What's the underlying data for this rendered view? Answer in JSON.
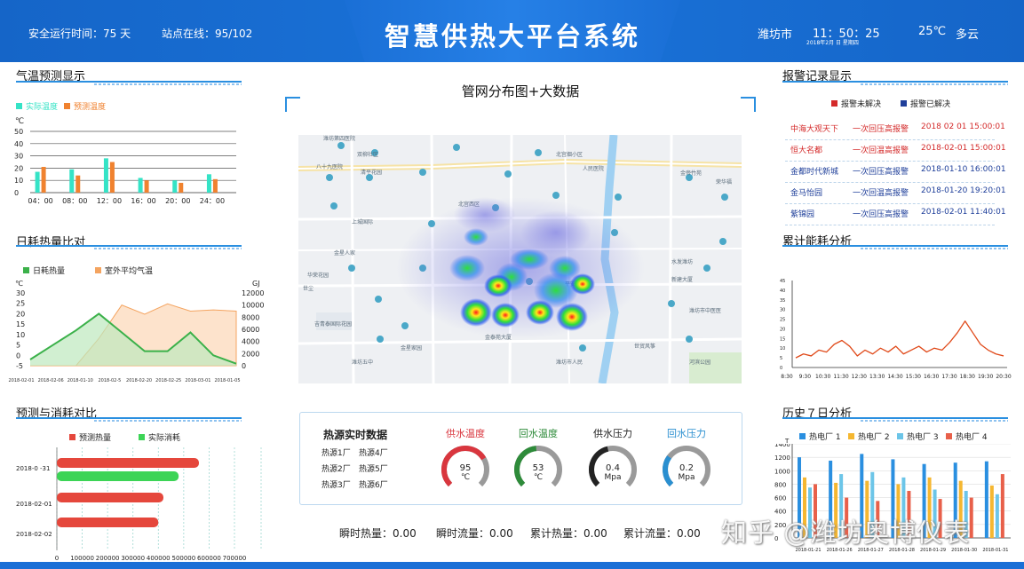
{
  "header": {
    "runtime": "安全运行时间：75 天",
    "stations": "站点在线：95/102",
    "title": "智慧供热大平台系统",
    "city": "潍坊市",
    "time": "11：50：25",
    "date": "2018年2月 日 星期四",
    "temperature": "25℃",
    "weather": "多云"
  },
  "temp_forecast": {
    "title": "气温预测显示",
    "legend": [
      "实际温度",
      "预测温度"
    ],
    "unit": "℃",
    "colors": [
      "#35e3c6",
      "#f0822f"
    ],
    "chart_data": {
      "type": "bar",
      "categories": [
        "04：00",
        "08：00",
        "12：00",
        "16：00",
        "20：00",
        "24：00"
      ],
      "yticks": [
        "50",
        "40",
        "30",
        "20",
        "10",
        "0"
      ],
      "series": [
        {
          "name": "实际温度",
          "values": [
            17,
            19,
            28,
            12,
            10,
            15
          ]
        },
        {
          "name": "预测温度",
          "values": [
            21,
            14,
            25,
            10,
            8,
            11
          ]
        }
      ],
      "ylim": [
        0,
        50
      ]
    }
  },
  "daily_heat": {
    "title": "日耗热量比对",
    "legend": [
      "日耗热量",
      "室外平均气温"
    ],
    "unit_left": "℃",
    "unit_right": "GJ",
    "colors": [
      "#3bb14a",
      "#f4a460"
    ],
    "chart_data": {
      "type": "area",
      "categories": [
        "2018-02-01",
        "2018-02-06",
        "2018-01-10",
        "2018-02-5",
        "2018-02-20",
        "2018-02-25",
        "2018-03-01",
        "2018-01-05"
      ],
      "yticks_left": [
        "30",
        "25",
        "20",
        "15",
        "10",
        "5",
        "0",
        "-5"
      ],
      "yticks_right": [
        "12000",
        "10000",
        "8000",
        "6000",
        "4000",
        "2000",
        "0"
      ],
      "series": [
        {
          "name": "日耗热量",
          "axis": "left",
          "values": [
            -2,
            5,
            12,
            20,
            11,
            2,
            2,
            11,
            0,
            -4
          ]
        },
        {
          "name": "室外平均气温",
          "axis": "right",
          "values": [
            0,
            0,
            0,
            4500,
            10000,
            8500,
            10200,
            9000,
            9200,
            9000
          ]
        }
      ],
      "ylim_left": [
        -5,
        30
      ],
      "ylim_right": [
        0,
        12000
      ]
    }
  },
  "forecast_vs": {
    "title": "预测与消耗对比",
    "legend": [
      "预测热量",
      "实际消耗"
    ],
    "colors": [
      "#e5473c",
      "#3cd456"
    ],
    "chart_data": {
      "type": "bar",
      "orientation": "horizontal",
      "categories": [
        "2018-0 -31",
        "2018-02-01",
        "2018-02-02"
      ],
      "xticks": [
        "0",
        "100000",
        "200000",
        "300000",
        "400000",
        "500000",
        "600000",
        "700000"
      ],
      "series": [
        {
          "name": "预测热量",
          "values": [
            560000,
            0,
            0
          ]
        },
        {
          "name": "实际消耗",
          "values": [
            480000,
            0,
            0
          ]
        },
        {
          "name": "预测热量",
          "values": [
            0,
            420000,
            0
          ]
        },
        {
          "name": "预测热量",
          "values": [
            0,
            0,
            400000
          ]
        }
      ],
      "xlim": [
        0,
        700000
      ]
    }
  },
  "map": {
    "title": "管网分布图+大数据"
  },
  "realtime": {
    "title": "热源实时数据",
    "sources": [
      "热源1厂",
      "热源4厂",
      "热源2厂",
      "热源5厂",
      "热源3厂",
      "热源6厂"
    ],
    "gauges": [
      {
        "label": "供水温度",
        "value": "95",
        "unit": "℃",
        "color": "#d9363e",
        "level": 0.72
      },
      {
        "label": "回水温度",
        "value": "53",
        "unit": "℃",
        "color": "#2e8b3a",
        "level": 0.48
      },
      {
        "label": "供水压力",
        "value": "0.4",
        "unit": "Mpa",
        "color": "#222222",
        "level": 0.45
      },
      {
        "label": "回水压力",
        "value": "0.2",
        "unit": "Mpa",
        "color": "#2a8fd0",
        "level": 0.3
      }
    ]
  },
  "totals": {
    "instant_heat": "瞬时热量：0.00",
    "instant_flow": "瞬时流量：0.00",
    "total_heat": "累计热量：0.00",
    "total_flow": "累计流量：0.00"
  },
  "alarms": {
    "title": "报警记录显示",
    "legend": [
      "报警未解决",
      "报警已解决"
    ],
    "colors": [
      "#d42a2a",
      "#1f3f9a"
    ],
    "rows": [
      {
        "place": "中海大观天下",
        "event": "一次回压高报警",
        "time": "2018 02 01 15:00:01",
        "resolved": false
      },
      {
        "place": "恒大名都",
        "event": "一次回温高报警",
        "time": "2018-02-01 15:00:01",
        "resolved": false
      },
      {
        "place": "金都时代新城",
        "event": "一次回压高报警",
        "time": "2018-01-10 16:00:01",
        "resolved": true
      },
      {
        "place": "金马怡园",
        "event": "一次回温高报警",
        "time": "2018-01-20 19:20:01",
        "resolved": true
      },
      {
        "place": "紫锦园",
        "event": "一次回压高报警",
        "time": "2018-02-01 11:40:01",
        "resolved": true
      }
    ]
  },
  "energy": {
    "title": "累计能耗分析",
    "color": "#e04a1a",
    "chart_data": {
      "type": "line",
      "categories": [
        "8:30",
        "9:30",
        "10:30",
        "11:30",
        "12:30",
        "13:30",
        "14:30",
        "15:30",
        "16:30",
        "17:30",
        "18:30",
        "19:30",
        "20:30"
      ],
      "yticks": [
        "45",
        "40",
        "35",
        "30",
        "25",
        "20",
        "15",
        "10",
        "5",
        "0"
      ],
      "series": [
        {
          "values": [
            5,
            7,
            6,
            9,
            8,
            12,
            14,
            11,
            6,
            9,
            7,
            10,
            8,
            11,
            7,
            9,
            11,
            8,
            10,
            9,
            13,
            18,
            24,
            18,
            12,
            9,
            7,
            6
          ]
        }
      ],
      "ylim": [
        0,
        45
      ]
    }
  },
  "history": {
    "title": "历史７日分析",
    "legend": [
      "热电厂 1",
      "热电厂 2",
      "热电厂 3",
      "热电厂 4"
    ],
    "colors": [
      "#2a8fe0",
      "#f5b731",
      "#6cc5e8",
      "#e8604a"
    ],
    "unit": "T",
    "chart_data": {
      "type": "bar",
      "categories": [
        "2018-01-21",
        "2018-01-26",
        "2018-01-27",
        "2018-01-28",
        "2018-01-29",
        "2018-01-30",
        "2018-01-31"
      ],
      "yticks": [
        "1400",
        "1200",
        "1000",
        "800",
        "600",
        "400",
        "200",
        "0"
      ],
      "series": [
        {
          "name": "热电厂 1",
          "values": [
            1200,
            1150,
            1250,
            1170,
            1100,
            1120,
            1140
          ]
        },
        {
          "name": "热电厂 2",
          "values": [
            900,
            820,
            850,
            800,
            900,
            850,
            780
          ]
        },
        {
          "name": "热电厂 3",
          "values": [
            750,
            950,
            980,
            900,
            720,
            700,
            650
          ]
        },
        {
          "name": "热电厂 4",
          "values": [
            800,
            600,
            550,
            700,
            580,
            600,
            950
          ]
        }
      ],
      "ylim": [
        0,
        1400
      ]
    }
  },
  "watermark": "知乎 @潍坊奥博仪表"
}
